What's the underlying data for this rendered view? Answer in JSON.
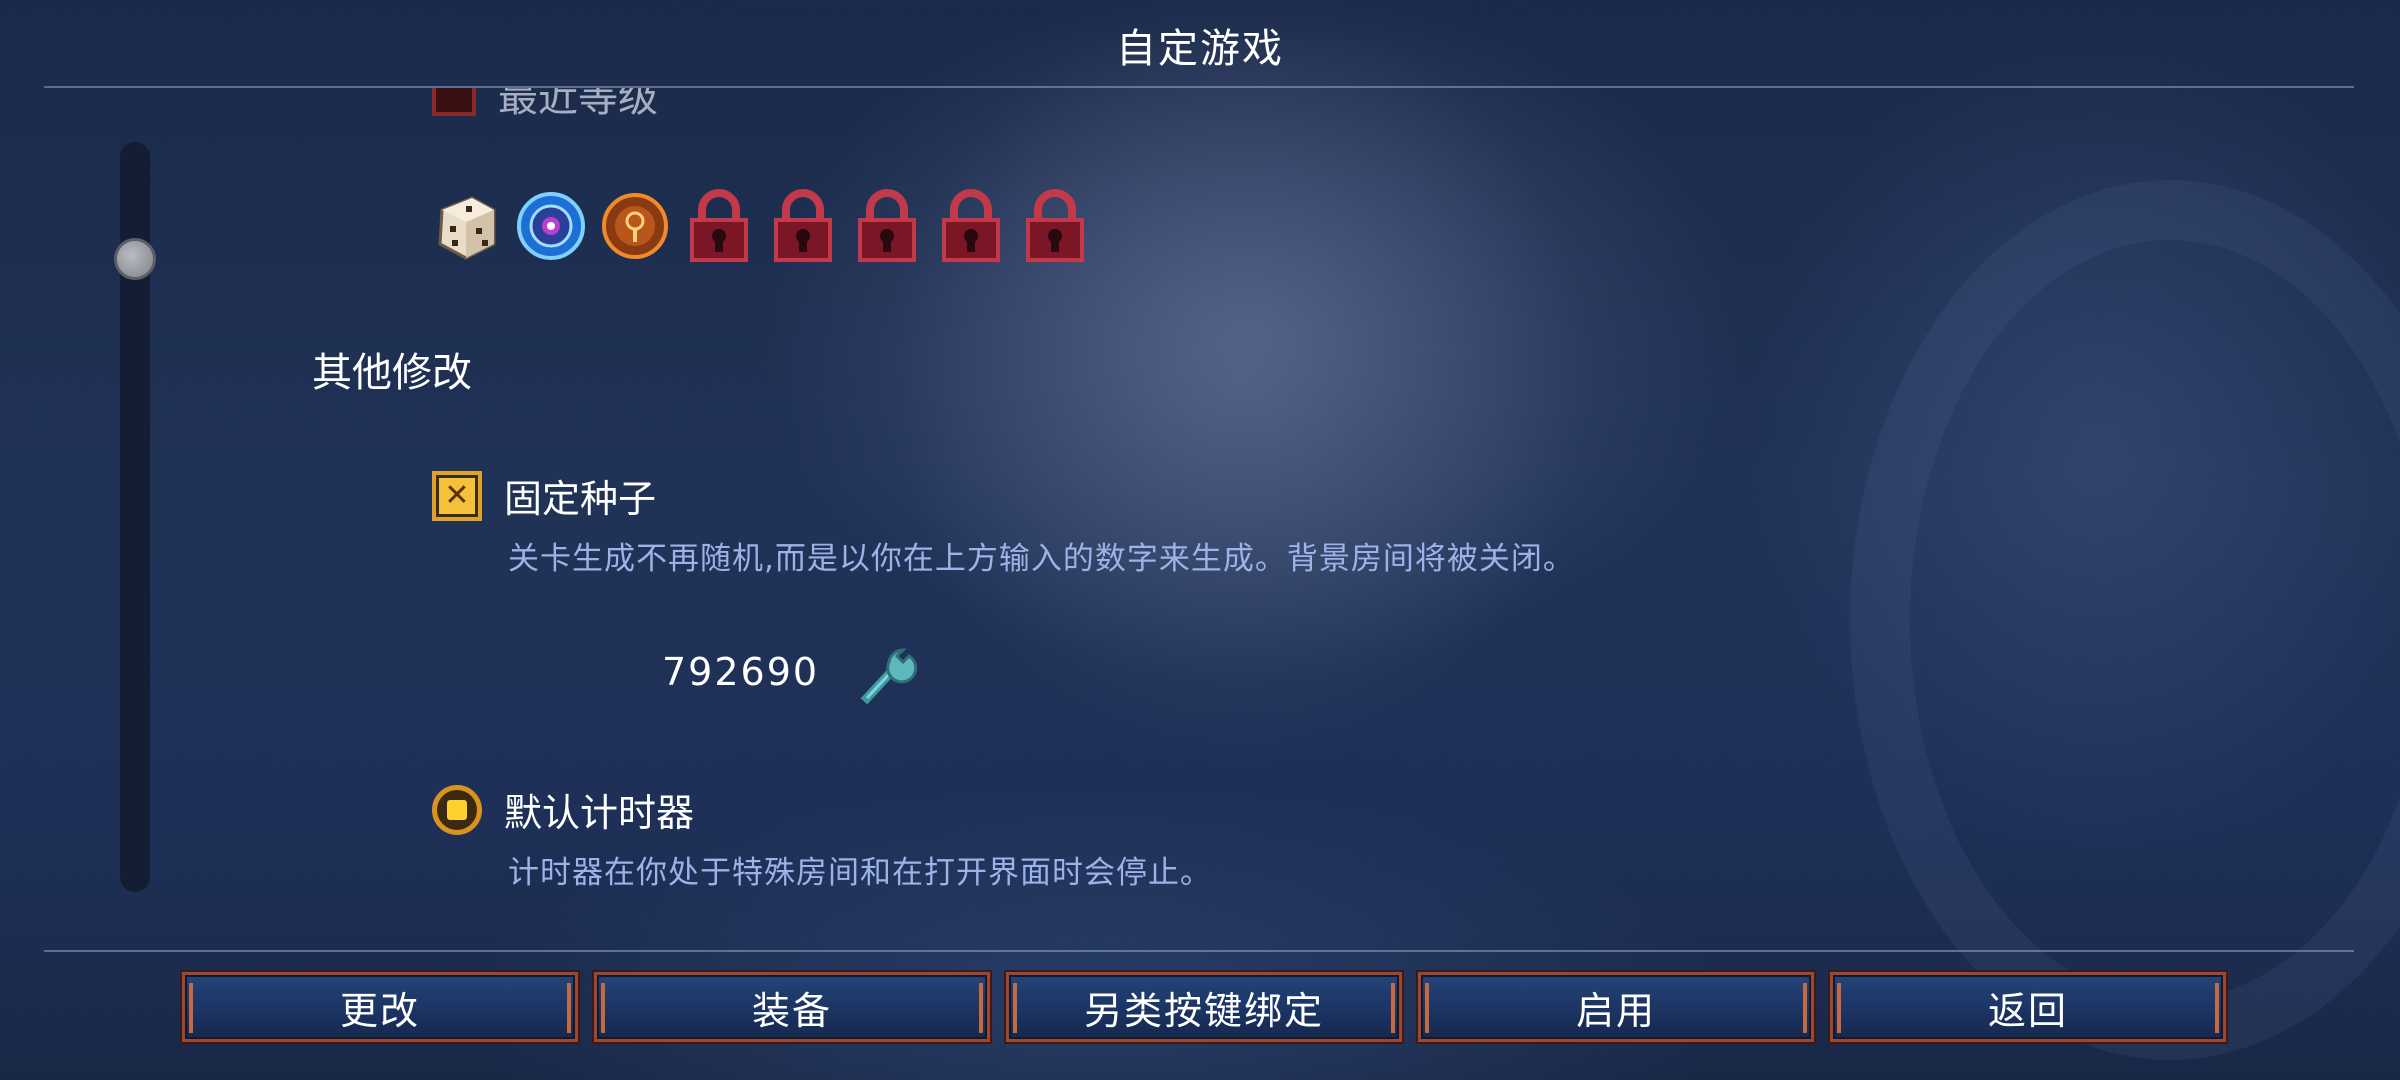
{
  "header": {
    "title": "自定游戏"
  },
  "clipped_item": {
    "label": "最近等级"
  },
  "icons": [
    "dice-icon",
    "blue-rune-icon",
    "orange-rune-icon",
    "lock-icon",
    "lock-icon",
    "lock-icon",
    "lock-icon",
    "lock-icon"
  ],
  "section": {
    "heading": "其他修改"
  },
  "seed_option": {
    "title": "固定种子",
    "description": "关卡生成不再随机,而是以你在上方输入的数字来生成。背景房间将被关闭。",
    "checked": true,
    "value": "792690"
  },
  "timer_option": {
    "title": "默认计时器",
    "description": "计时器在你处于特殊房间和在打开界面时会停止。",
    "selected": true
  },
  "buttons": {
    "change": "更改",
    "equip": "装备",
    "alt_keybind": "另类按键绑定",
    "enable": "启用",
    "back": "返回"
  },
  "colors": {
    "accent": "#f3c23a",
    "description_text": "#9db2e6",
    "button_border": "#9c4733",
    "lock_red": "#c23a4a"
  }
}
